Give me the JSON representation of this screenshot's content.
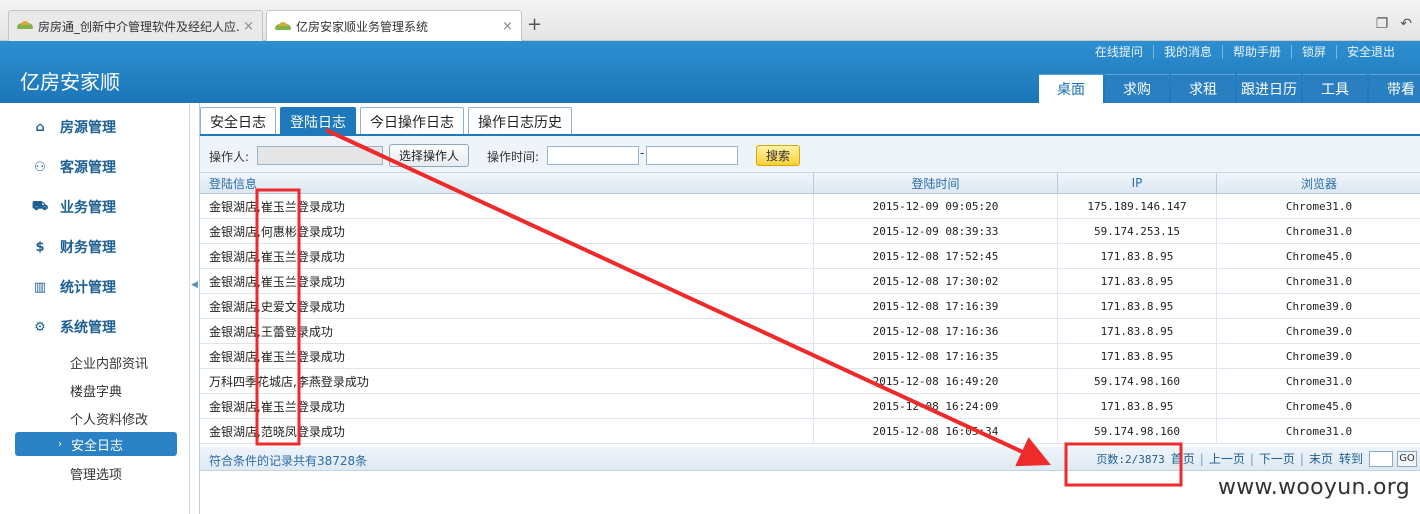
{
  "browser": {
    "tabs": [
      {
        "title": "房房通_创新中介管理软件及经纪人应...",
        "close": "×"
      },
      {
        "title": "亿房安家顺业务管理系统",
        "close": "×"
      }
    ],
    "new_tab": "+"
  },
  "app": {
    "title": "亿房安家顺",
    "top_links": [
      "在线提问",
      "我的消息",
      "帮助手册",
      "锁屏",
      "安全退出"
    ],
    "nav_tabs": [
      "桌面",
      "求购",
      "求租",
      "跟进日历",
      "工具",
      "带看"
    ]
  },
  "sidebar": {
    "menu": [
      {
        "label": "房源管理",
        "icon": "home-icon"
      },
      {
        "label": "客源管理",
        "icon": "users-icon"
      },
      {
        "label": "业务管理",
        "icon": "car-icon"
      },
      {
        "label": "财务管理",
        "icon": "money-icon"
      },
      {
        "label": "统计管理",
        "icon": "bar-chart-icon"
      },
      {
        "label": "系统管理",
        "icon": "gear-icon"
      }
    ],
    "submenu": [
      "企业内部资讯",
      "楼盘字典",
      "个人资料修改",
      "安全日志",
      "管理选项"
    ],
    "active_sub": "安全日志"
  },
  "content": {
    "tabs": [
      "安全日志",
      "登陆日志",
      "今日操作日志",
      "操作日志历史"
    ],
    "active_tab": "登陆日志",
    "filter": {
      "operator_label": "操作人:",
      "select_operator": "选择操作人",
      "time_label": "操作时间:",
      "search": "搜索"
    },
    "table": {
      "headers": [
        "登陆信息",
        "登陆时间",
        "IP",
        "浏览器"
      ],
      "rows": [
        [
          "金银湖店,崔玉兰登录成功",
          "2015-12-09 09:05:20",
          "175.189.146.147",
          "Chrome31.0"
        ],
        [
          "金银湖店,何惠彬登录成功",
          "2015-12-09 08:39:33",
          "59.174.253.15",
          "Chrome31.0"
        ],
        [
          "金银湖店,崔玉兰登录成功",
          "2015-12-08 17:52:45",
          "171.83.8.95",
          "Chrome45.0"
        ],
        [
          "金银湖店,崔玉兰登录成功",
          "2015-12-08 17:30:02",
          "171.83.8.95",
          "Chrome31.0"
        ],
        [
          "金银湖店,史爱文登录成功",
          "2015-12-08 17:16:39",
          "171.83.8.95",
          "Chrome39.0"
        ],
        [
          "金银湖店,王蕾登录成功",
          "2015-12-08 17:16:36",
          "171.83.8.95",
          "Chrome39.0"
        ],
        [
          "金银湖店,崔玉兰登录成功",
          "2015-12-08 17:16:35",
          "171.83.8.95",
          "Chrome39.0"
        ],
        [
          "万科四季花城店,李燕登录成功",
          "2015-12-08 16:49:20",
          "59.174.98.160",
          "Chrome31.0"
        ],
        [
          "金银湖店,崔玉兰登录成功",
          "2015-12-08 16:24:09",
          "171.83.8.95",
          "Chrome45.0"
        ],
        [
          "金银湖店,范晓凤登录成功",
          "2015-12-08 16:05:34",
          "59.174.98.160",
          "Chrome31.0"
        ]
      ]
    },
    "footer": {
      "total": "符合条件的记录共有38728条",
      "page_info": "页数:2/3873",
      "first": "首页",
      "prev": "上一页",
      "next": "下一页",
      "last": "末页",
      "goto": "转到",
      "go": "GO"
    }
  },
  "watermark": "www.wooyun.org",
  "colors": {
    "accent": "#1e78bc",
    "annotation": "#ee2a2a"
  }
}
